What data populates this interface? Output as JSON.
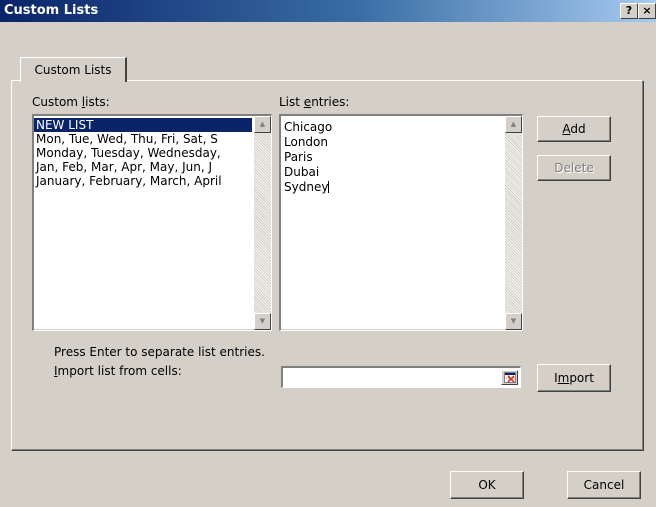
{
  "window": {
    "title": "Custom Lists",
    "help_label": "?",
    "close_label": "×"
  },
  "tabs": [
    {
      "label": "Custom Lists",
      "active": true
    }
  ],
  "custom_lists": {
    "label_before": "Custom ",
    "label_mnemonic": "l",
    "label_after": "ists:",
    "items": [
      {
        "text": "NEW LIST",
        "selected": true
      },
      {
        "text": "Mon, Tue, Wed, Thu, Fri, Sat, S",
        "selected": false
      },
      {
        "text": "Monday, Tuesday, Wednesday,",
        "selected": false
      },
      {
        "text": "Jan, Feb, Mar, Apr, May, Jun, J",
        "selected": false
      },
      {
        "text": "January, February, March, April",
        "selected": false
      }
    ]
  },
  "list_entries": {
    "label_before": "List ",
    "label_mnemonic": "e",
    "label_after": "ntries:",
    "entries": [
      "Chicago",
      "London",
      "Paris",
      "Dubai",
      "Sydney"
    ]
  },
  "buttons": {
    "add_mnemonic": "A",
    "add_rest": "dd",
    "delete_label": "Delete",
    "import_before": "I",
    "import_mnemonic": "m",
    "import_after": "port",
    "ok_label": "OK",
    "cancel_label": "Cancel"
  },
  "hint_text": "Press Enter to separate list entries.",
  "import_range": {
    "label_mnemonic": "I",
    "label_rest": "mport list from cells:",
    "value": ""
  },
  "icons": {
    "scroll_up": "scroll-up-arrow-icon",
    "scroll_down": "scroll-down-arrow-icon",
    "range_picker": "collapse-dialog-icon"
  },
  "colors": {
    "selection": "#0a246a",
    "titlebar_start": "#0a246a",
    "dialog_face": "#d4d0c8"
  }
}
